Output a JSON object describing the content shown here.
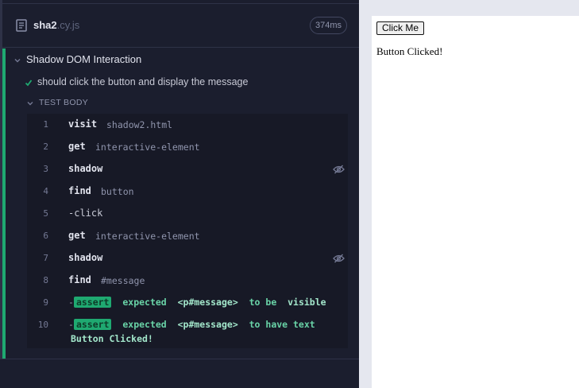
{
  "file": {
    "name": "sha2",
    "ext": ".cy.js",
    "duration": "374ms"
  },
  "suite": {
    "title": "Shadow DOM Interaction"
  },
  "test": {
    "title": "should click the button and display the message"
  },
  "body_label": "TEST BODY",
  "commands": [
    {
      "num": "1",
      "name": "visit",
      "arg": "shadow2.html"
    },
    {
      "num": "2",
      "name": "get",
      "arg": "interactive-element"
    },
    {
      "num": "3",
      "name": "shadow",
      "arg": ""
    },
    {
      "num": "4",
      "name": "find",
      "arg": "button"
    },
    {
      "num": "5",
      "name": "-click",
      "arg": ""
    },
    {
      "num": "6",
      "name": "get",
      "arg": "interactive-element"
    },
    {
      "num": "7",
      "name": "shadow",
      "arg": ""
    },
    {
      "num": "8",
      "name": "find",
      "arg": "#message"
    },
    {
      "num": "9",
      "dash": "-",
      "badge": "assert",
      "expected": "expected",
      "subject": "<p#message>",
      "rel": "to be",
      "value": "visible"
    },
    {
      "num": "10",
      "dash": "-",
      "badge": "assert",
      "expected": "expected",
      "subject": "<p#message>",
      "rel": "to have text",
      "value": "Button Clicked!"
    }
  ],
  "aut": {
    "button_label": "Click Me",
    "message": "Button Clicked!"
  },
  "colors": {
    "pass": "#1fa971",
    "panel_bg": "#1b1e2e",
    "commands_bg": "#171926"
  },
  "icons": {
    "file": "file-icon",
    "check": "check-icon",
    "hidden": "eye-slash-icon",
    "chevron": "chevron-down-icon"
  }
}
